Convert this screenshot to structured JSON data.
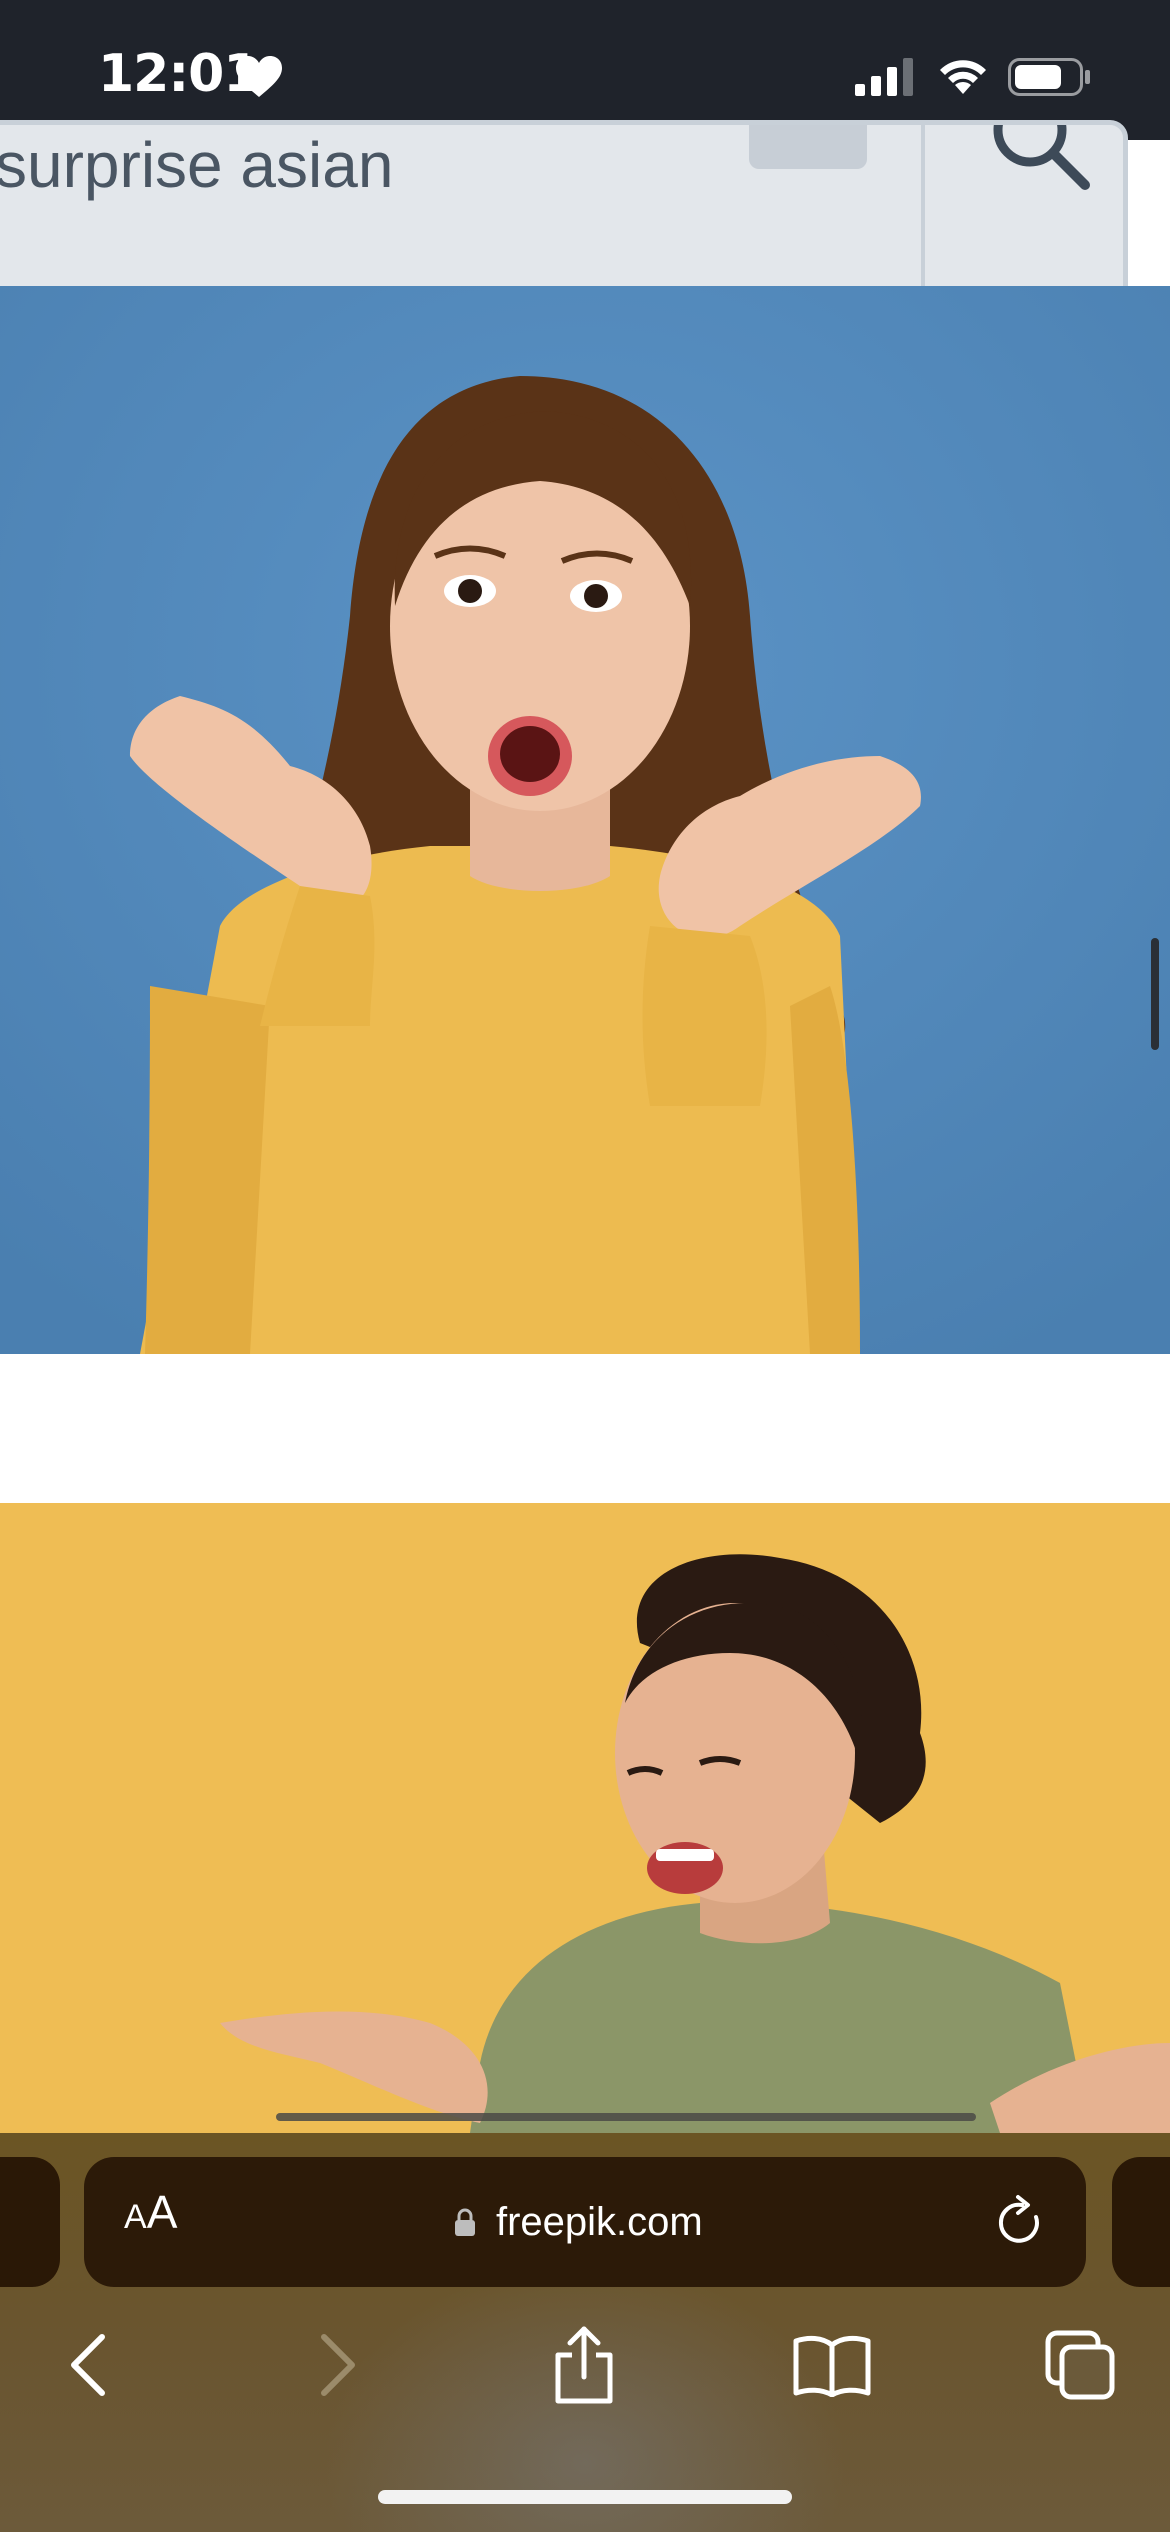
{
  "status_bar": {
    "time": "12:01",
    "icons": [
      "heart-icon",
      "cellular-signal-icon",
      "wifi-icon",
      "battery-icon"
    ]
  },
  "search": {
    "query": "surprise asian",
    "icons": [
      "clear-icon",
      "search-icon"
    ]
  },
  "results": [
    {
      "description_icon": "photo",
      "background": "#4f86b8"
    },
    {
      "description_icon": "photo",
      "background": "#efbd54"
    }
  ],
  "safari": {
    "reader_label_small": "A",
    "reader_label_large": "A",
    "url": "freepik.com",
    "icons": [
      "lock-icon",
      "reload-icon",
      "back-icon",
      "forward-icon",
      "share-icon",
      "bookmarks-icon",
      "tabs-icon"
    ]
  },
  "colors": {
    "status_bar_bg": "#1f232b",
    "search_bg": "#e3e7eb",
    "photo1_bg": "#4f86b8",
    "photo2_bg": "#efbd54",
    "toolbar_bg": "#6b5524",
    "address_bar_bg": "#2c1a08"
  }
}
